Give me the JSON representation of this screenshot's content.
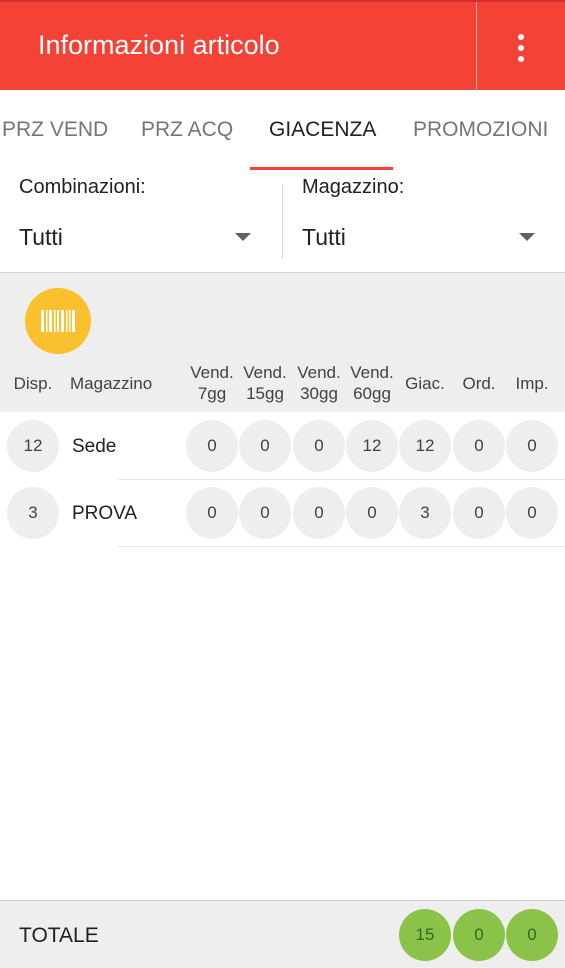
{
  "appbar": {
    "title": "Informazioni articolo",
    "menu_icon": "more-vert-icon",
    "color": "#f44336"
  },
  "tabs": [
    {
      "label": "PRZ VEND"
    },
    {
      "label": "PRZ ACQ"
    },
    {
      "label": "GIACENZA",
      "active": true
    },
    {
      "label": "PROMOZIONI"
    }
  ],
  "filters": {
    "combinazioni": {
      "label": "Combinazioni:",
      "value": "Tutti"
    },
    "magazzino": {
      "label": "Magazzino:",
      "value": "Tutti"
    }
  },
  "barcode_button": {
    "icon": "barcode-icon",
    "color": "#fbc02d"
  },
  "table": {
    "headers": {
      "disp": "Disp.",
      "magazzino": "Magazzino",
      "vend7": [
        "Vend.",
        "7gg"
      ],
      "vend15": [
        "Vend.",
        "15gg"
      ],
      "vend30": [
        "Vend.",
        "30gg"
      ],
      "vend60": [
        "Vend.",
        "60gg"
      ],
      "giac": "Giac.",
      "ord": "Ord.",
      "imp": "Imp."
    },
    "rows": [
      {
        "disp": "12",
        "name": "Sede",
        "vend7": "0",
        "vend15": "0",
        "vend30": "0",
        "vend60": "12",
        "giac": "12",
        "ord": "0",
        "imp": "0"
      },
      {
        "disp": "3",
        "name": "PROVA",
        "vend7": "0",
        "vend15": "0",
        "vend30": "0",
        "vend60": "0",
        "giac": "3",
        "ord": "0",
        "imp": "0"
      }
    ]
  },
  "footer": {
    "label": "TOTALE",
    "giac": "15",
    "ord": "0",
    "imp": "0",
    "color": "#8bc34a"
  }
}
